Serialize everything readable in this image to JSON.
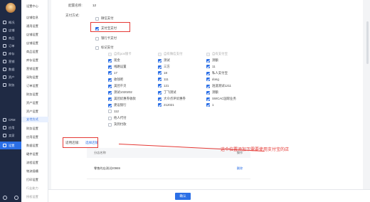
{
  "sidebar": {
    "items": [
      {
        "label": "概况",
        "icon": "home-icon"
      },
      {
        "label": "店铺",
        "icon": "store-icon"
      },
      {
        "label": "商品",
        "icon": "goods-icon"
      },
      {
        "label": "订单",
        "icon": "order-icon"
      },
      {
        "label": "库存",
        "icon": "stock-icon"
      },
      {
        "label": "营销",
        "icon": "marketing-icon"
      },
      {
        "label": "数据",
        "icon": "data-icon"
      },
      {
        "label": "资产",
        "icon": "asset-icon"
      },
      {
        "label": "财务",
        "icon": "finance-icon"
      },
      {
        "label": "CRM",
        "icon": "crm-icon"
      },
      {
        "label": "应用",
        "icon": "app-icon"
      },
      {
        "label": "卖家",
        "icon": "seller-icon"
      },
      {
        "label": "设置",
        "icon": "settings-icon"
      }
    ]
  },
  "subnav": {
    "items": [
      "设置中心",
      "店铺信息",
      "通用设置",
      "店铺设置",
      "店铺设置",
      "商品设置",
      "库存设置",
      "营销设置",
      "采购设置",
      "订单设置",
      "财务设置",
      "资产设置",
      "资产设置",
      "支付方式",
      "财务设置",
      "应用设置",
      "数据设置",
      "硬件设置",
      "流程设置",
      "物流插槽",
      "打印设置",
      "行业能力",
      "授权设置"
    ]
  },
  "form": {
    "config_label": "配置名称:",
    "config_value": "12",
    "pay_label": "支付方式:",
    "methods": [
      "微信支付",
      "支付宝支付",
      "银行卡支付",
      "标记支付"
    ],
    "shop_label": "适用店铺:",
    "shop_link": "选择店铺"
  },
  "grid": [
    [
      "自有pos银卡",
      "自有微信支付",
      "自有支付宝"
    ],
    [
      "现金",
      "测试",
      "测额"
    ],
    [
      "线路设置",
      "三方",
      "11"
    ],
    [
      "17",
      "18",
      "私人支付宝"
    ],
    [
      "收钱吧",
      "111",
      "dong"
    ],
    [
      "美团千贝",
      "121",
      "逍遥测试1211"
    ],
    [
      "测试1020202",
      "丁飞测试",
      "测额"
    ],
    [
      "美团优惠券收款",
      "大众点评优惠券",
      "SWCAC国际业务"
    ],
    [
      "建设银行",
      "212021",
      "1"
    ],
    [
      "112",
      "",
      ""
    ],
    [
      "他人代付",
      "",
      ""
    ],
    [
      "货到付款",
      "",
      ""
    ]
  ],
  "table": {
    "col_name": "分店名称",
    "col_op": "操作",
    "row_name": "零售的店测试20969",
    "row_op": "删除"
  },
  "annotation": "这个位置添加下需要使用支付宝的店",
  "footer": {
    "ok": "确认"
  }
}
